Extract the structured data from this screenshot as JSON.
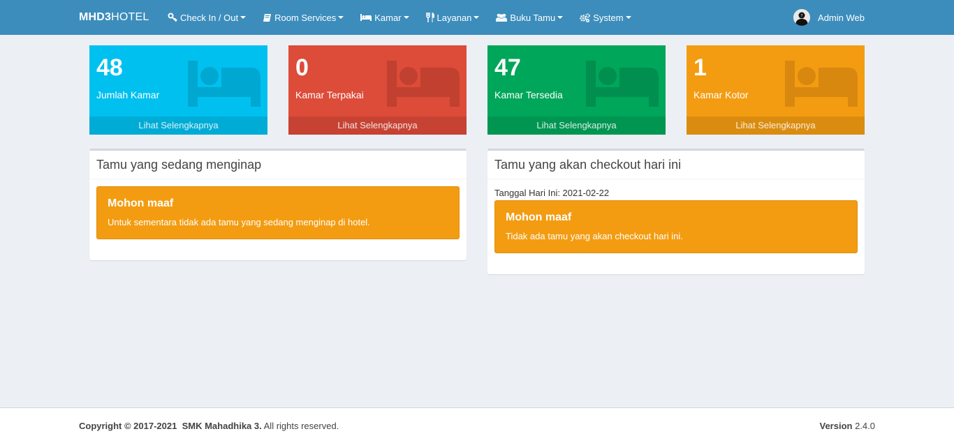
{
  "brand": {
    "bold": "MHD3",
    "rest": "HOTEL"
  },
  "nav": [
    {
      "label": "Check In / Out",
      "icon": "key-icon"
    },
    {
      "label": "Room Services",
      "icon": "book-icon"
    },
    {
      "label": "Kamar",
      "icon": "bed-icon"
    },
    {
      "label": "Layanan",
      "icon": "cutlery-icon"
    },
    {
      "label": "Buku Tamu",
      "icon": "users-icon"
    },
    {
      "label": "System",
      "icon": "cogs-icon"
    }
  ],
  "user": {
    "name": "Admin Web"
  },
  "stats": [
    {
      "value": "48",
      "label": "Jumlah Kamar",
      "link": "Lihat Selengkapnya",
      "color": "#00c0ef",
      "footer_color": "#00acd6",
      "icon_color": "#00a7d0"
    },
    {
      "value": "0",
      "label": "Kamar Terpakai",
      "link": "Lihat Selengkapnya",
      "color": "#dd4b39",
      "footer_color": "#c64333",
      "icon_color": "#c1402f"
    },
    {
      "value": "47",
      "label": "Kamar Tersedia",
      "link": "Lihat Selengkapnya",
      "color": "#00a65a",
      "footer_color": "#009551",
      "icon_color": "#008f4e"
    },
    {
      "value": "1",
      "label": "Kamar Kotor",
      "link": "Lihat Selengkapnya",
      "color": "#f39c12",
      "footer_color": "#da8c10",
      "icon_color": "#d8880f"
    }
  ],
  "panels": {
    "staying": {
      "title": "Tamu yang sedang menginap",
      "alert_title": "Mohon maaf",
      "alert_text": "Untuk sementara tidak ada tamu yang sedang menginap di hotel."
    },
    "checkout": {
      "title": "Tamu yang akan checkout hari ini",
      "date_label": "Tanggal Hari Ini: 2021-02-22",
      "alert_title": "Mohon maaf",
      "alert_text": "Tidak ada tamu yang akan checkout hari ini."
    }
  },
  "footer": {
    "copyright": "Copyright © 2017-2021",
    "org": "SMK Mahadhika 3.",
    "rights": "All rights reserved.",
    "version_label": "Version",
    "version": "2.4.0"
  },
  "colors": {
    "navbar": "#3c8dbc",
    "background": "#ecf0f5",
    "alert": "#f39c12"
  }
}
